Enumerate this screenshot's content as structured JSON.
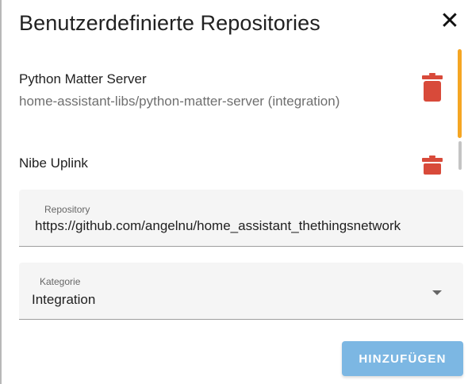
{
  "dialog": {
    "title": "Benutzerdefinierte Repositories",
    "close_icon": "close-icon"
  },
  "repositories": [
    {
      "name": "Python Matter Server",
      "subtitle": "home-assistant-libs/python-matter-server (integration)",
      "delete_icon": "trash-icon"
    },
    {
      "name": "Nibe Uplink",
      "subtitle": "",
      "delete_icon": "trash-icon"
    }
  ],
  "form": {
    "repository": {
      "label": "Repository",
      "value": "https://github.com/angelnu/home_assistant_thethingsnetwork"
    },
    "category": {
      "label": "Kategorie",
      "value": "Integration",
      "arrow_icon": "dropdown-arrow-icon"
    },
    "add_button_label": "HINZUFÜGEN"
  },
  "colors": {
    "delete_red": "#d84a3a",
    "scroll_thumb": "#f5a623",
    "button_blue": "#7cb7e3"
  }
}
